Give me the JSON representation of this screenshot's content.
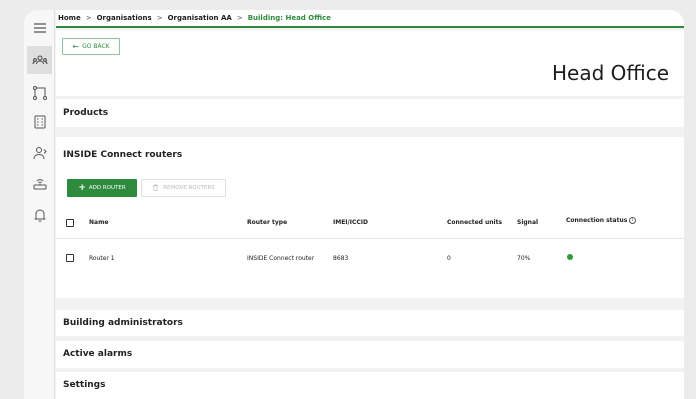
{
  "breadcrumb": {
    "items": [
      "Home",
      "Organisations",
      "Organisation AA",
      "Building: Head Office"
    ],
    "separator": ">"
  },
  "back_button": {
    "label": "GO BACK"
  },
  "page": {
    "title": "Head Office"
  },
  "sections": {
    "products": "Products",
    "routers": "INSIDE Connect routers",
    "building_admins": "Building administrators",
    "active_alarms": "Active alarms",
    "settings": "Settings"
  },
  "toolbar": {
    "add_label": "ADD ROUTER",
    "remove_label": "REMOVE ROUTERS"
  },
  "table": {
    "columns": [
      "Name",
      "Router type",
      "IMEI/ICCID",
      "Connected units",
      "Signal",
      "Connection status"
    ],
    "rows": [
      {
        "name": "Router 1",
        "router_type": "INSIDE Connect router",
        "imei": "8683",
        "connected_units": "0",
        "signal": "70%",
        "status_color": "#2e9a3a"
      }
    ]
  },
  "rail_icons": [
    "menu-icon",
    "organisations-icon",
    "hierarchy-icon",
    "building-icon",
    "users-icon",
    "router-icon",
    "bell-icon"
  ],
  "colors": {
    "accent": "#2e8b3e"
  }
}
